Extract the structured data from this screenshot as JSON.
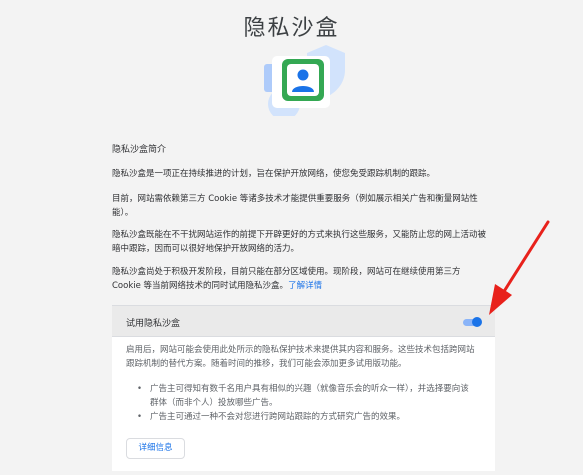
{
  "page": {
    "title": "隐私沙盒"
  },
  "intro": {
    "heading": "隐私沙盒简介",
    "paragraph_1": "隐私沙盒是一项正在持续推进的计划，旨在保护开放网络，使您免受跟踪机制的跟踪。",
    "paragraph_2": "目前，网站需依赖第三方 Cookie 等诸多技术才能提供重要服务（例如展示相关广告和衡量网站性能）。",
    "paragraph_3": "隐私沙盒既能在不干扰网站运作的前提下开辟更好的方式来执行这些服务，又能防止您的网上活动被暗中跟踪，因而可以很好地保护开放网络的活力。",
    "paragraph_4": "隐私沙盒尚处于积极开发阶段，目前只能在部分区域使用。现阶段，网站可在继续使用第三方 Cookie 等当前网络技术的同时试用隐私沙盒。",
    "learn_more": "了解详情"
  },
  "trial": {
    "title": "试用隐私沙盒",
    "toggle_state": "on",
    "description": "启用后，网站可能会使用此处所示的隐私保护技术来提供其内容和服务。这些技术包括跨网站跟踪机制的替代方案。随着时间的推移，我们可能会添加更多试用版功能。",
    "bullets": [
      "广告主可得知有数千名用户具有相似的兴趣（就像音乐会的听众一样），并选择要向该群体（而非个人）投放哪些广告。",
      "广告主可通过一种不会对您进行跨网站跟踪的方式研究广告的效果。"
    ],
    "bullet_mark": "•",
    "details_button": "详细信息"
  },
  "colors": {
    "accent": "#1a73e8",
    "annotation_arrow": "#e8211b",
    "page_background": "#f3f3f3"
  },
  "icons": {
    "hero": "privacy-sandbox-illustration",
    "annotation": "red-annotation-arrow"
  }
}
